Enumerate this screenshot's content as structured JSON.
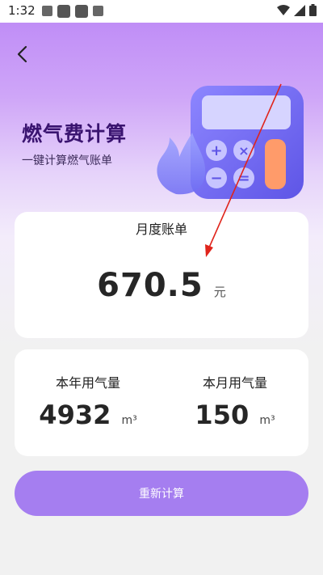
{
  "status_bar": {
    "time": "1:32"
  },
  "header": {
    "title": "燃气费计算",
    "subtitle": "一键计算燃气账单"
  },
  "bill_card": {
    "label": "月度账单",
    "amount": "670.5",
    "unit": "元"
  },
  "usage_card": {
    "yearly": {
      "label": "本年用气量",
      "value": "4932",
      "unit": "m³"
    },
    "monthly": {
      "label": "本月用气量",
      "value": "150",
      "unit": "m³"
    }
  },
  "actions": {
    "recalculate_label": "重新计算"
  },
  "colors": {
    "accent": "#a57ef0",
    "title": "#3a1470",
    "annotation_arrow": "#e0241b"
  },
  "icons": [
    "back-arrow-icon",
    "calculator-illustration",
    "flame-icon"
  ]
}
